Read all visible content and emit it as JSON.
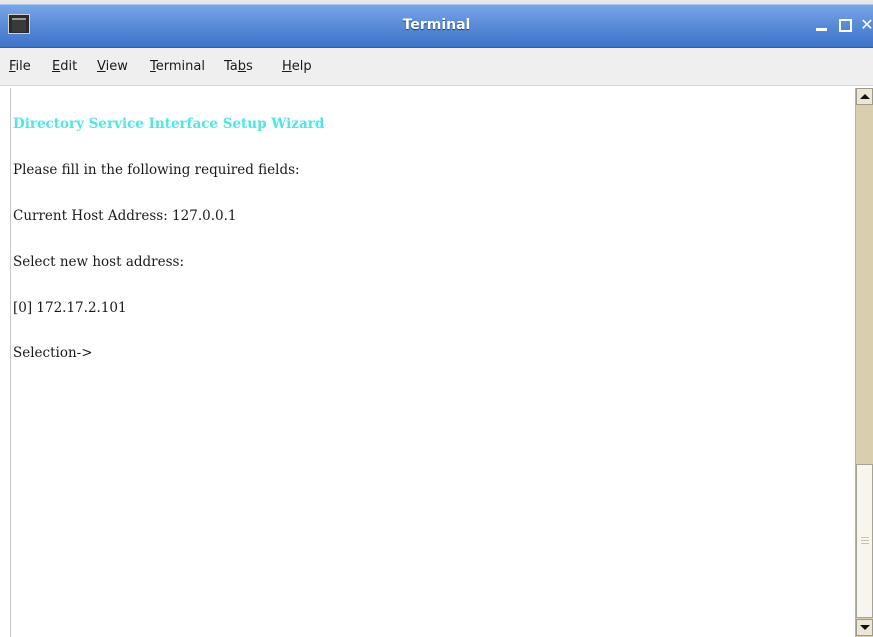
{
  "window": {
    "title": "Terminal"
  },
  "menubar": {
    "items": [
      {
        "label": "File",
        "mnemonic": "F",
        "rest": "ile"
      },
      {
        "label": "Edit",
        "mnemonic": "E",
        "rest": "dit"
      },
      {
        "label": "View",
        "mnemonic": "V",
        "rest": "iew"
      },
      {
        "label": "Terminal",
        "mnemonic": "T",
        "rest": "erminal"
      },
      {
        "label": "Tabs",
        "pre": "Ta",
        "mnemonic": "b",
        "rest": "s"
      },
      {
        "label": "Help",
        "mnemonic": "H",
        "rest": "elp"
      }
    ]
  },
  "terminal": {
    "lines": [
      "Directory Service Interface Setup Wizard",
      "Please fill in the following required fields:",
      "Current Host Address: 127.0.0.1",
      "Select new host address:",
      "[0] 172.17.2.101",
      "Selection->"
    ],
    "header_color": "#4fe6e6"
  },
  "colors": {
    "titlebar": "#5a8cd8",
    "menubar": "#efefef",
    "scrollbar_track": "#d9cfae"
  },
  "icons": {
    "app": "terminal-icon",
    "minimize": "minimize-icon",
    "maximize": "maximize-icon",
    "close": "close-icon"
  }
}
